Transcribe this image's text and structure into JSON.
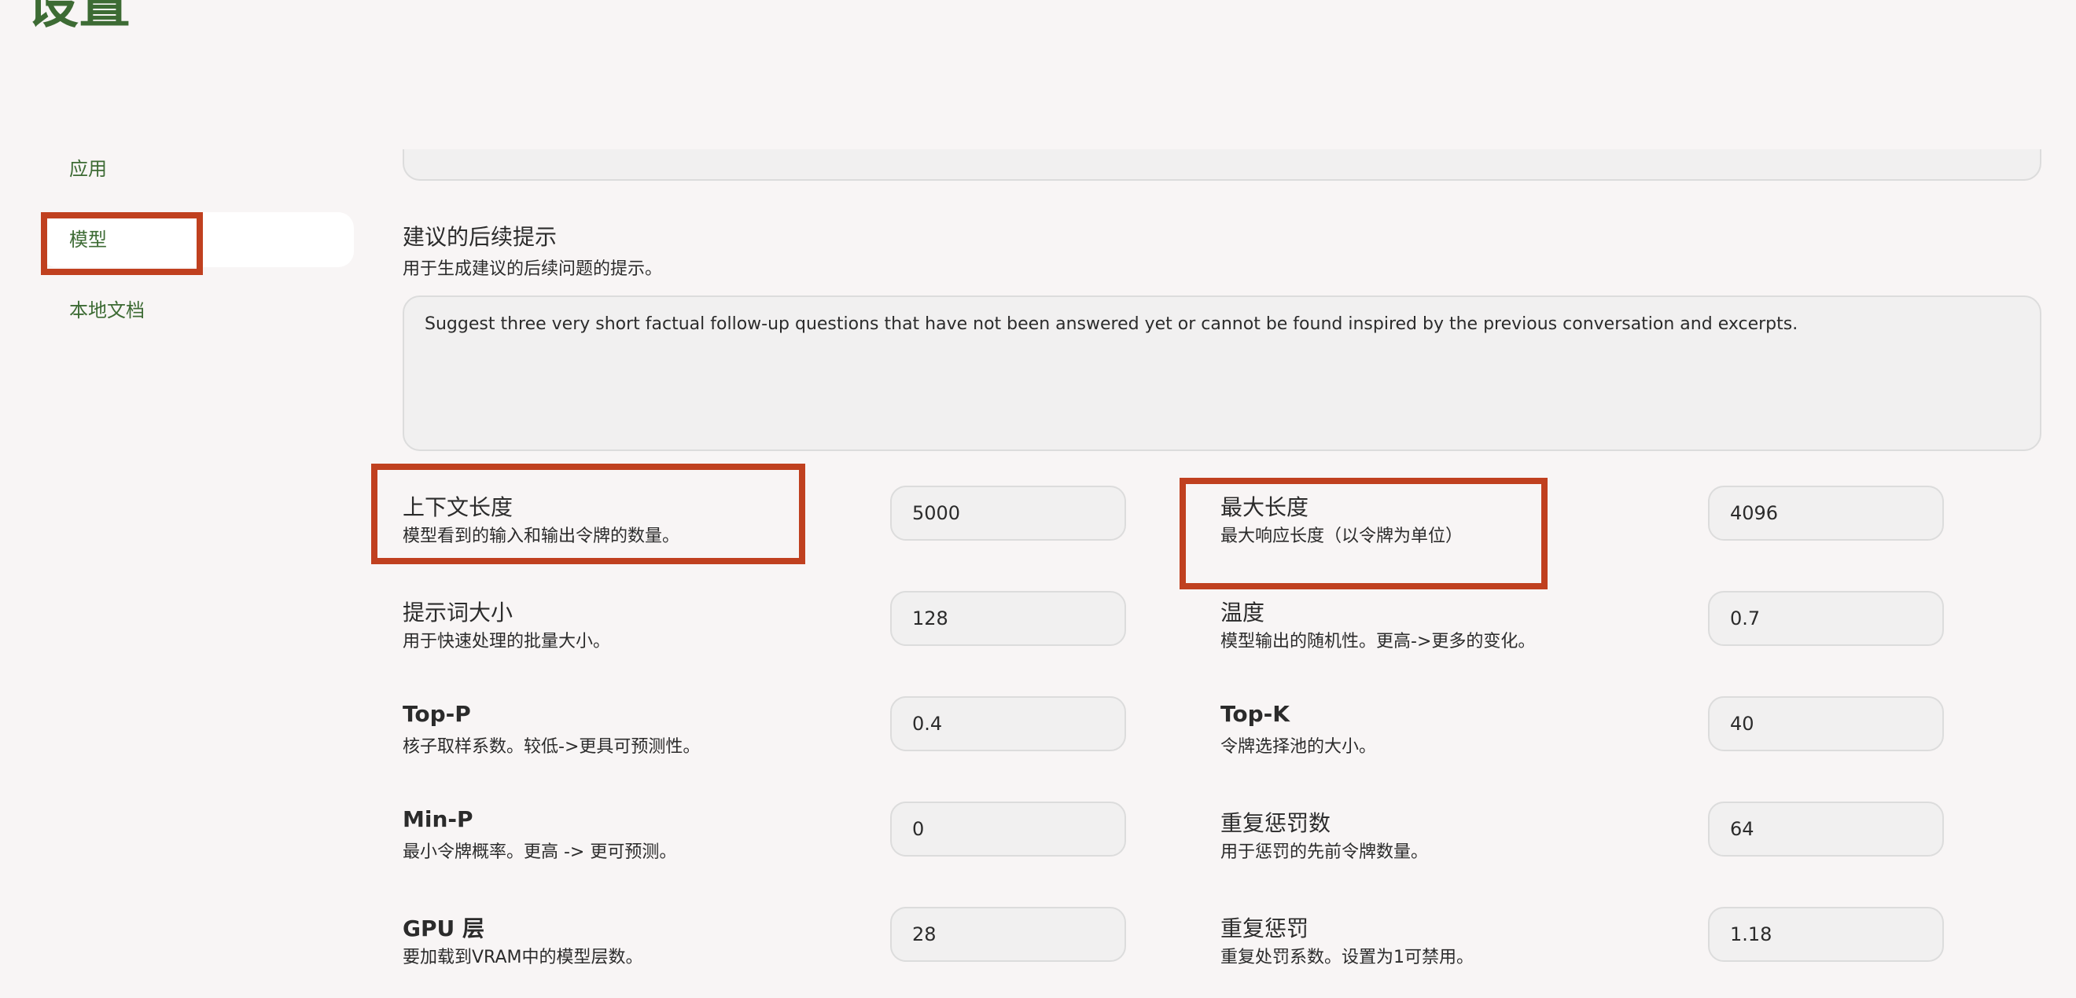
{
  "page": {
    "title": "设置"
  },
  "sidebar": {
    "items": [
      {
        "label": "应用"
      },
      {
        "label": "模型"
      },
      {
        "label": "本地文档"
      }
    ]
  },
  "suggested_followup": {
    "heading": "建议的后续提示",
    "description": "用于生成建议的后续问题的提示。",
    "value": "Suggest three very short factual follow-up questions that have not been answered yet or cannot be found inspired by the previous conversation and excerpts."
  },
  "settings": {
    "context_length": {
      "label": "上下文长度",
      "description": "模型看到的输入和输出令牌的数量。",
      "value": "5000"
    },
    "max_length": {
      "label": "最大长度",
      "description": "最大响应长度（以令牌为单位）",
      "value": "4096"
    },
    "prompt_batch_size": {
      "label": "提示词大小",
      "description": "用于快速处理的批量大小。",
      "value": "128"
    },
    "temperature": {
      "label": "温度",
      "description": "模型输出的随机性。更高->更多的变化。",
      "value": "0.7"
    },
    "top_p": {
      "label": "Top-P",
      "description": "核子取样系数。较低->更具可预测性。",
      "value": "0.4"
    },
    "top_k": {
      "label": "Top-K",
      "description": "令牌选择池的大小。",
      "value": "40"
    },
    "min_p": {
      "label": "Min-P",
      "description": "最小令牌概率。更高 -> 更可预测。",
      "value": "0"
    },
    "repeat_penalty_tokens": {
      "label": "重复惩罚数",
      "description": "用于惩罚的先前令牌数量。",
      "value": "64"
    },
    "gpu_layers": {
      "label": "GPU 层",
      "description": "要加载到VRAM中的模型层数。",
      "value": "28"
    },
    "repeat_penalty": {
      "label": "重复惩罚",
      "description": "重复处罚系数。设置为1可禁用。",
      "value": "1.18"
    }
  },
  "colors": {
    "accent": "#3d6b34",
    "highlight": "#c0401f",
    "background": "#f8f5f5",
    "field": "#f1f0f0"
  }
}
